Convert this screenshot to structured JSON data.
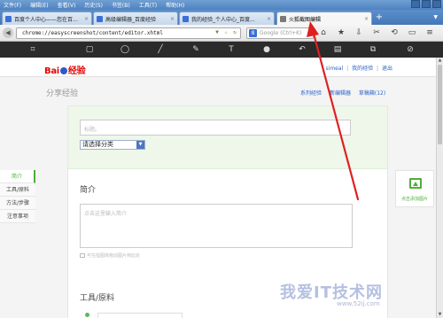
{
  "menubar": {
    "items": [
      "文件(F)",
      "编辑(E)",
      "查看(V)",
      "历史(S)",
      "书签(B)",
      "工具(T)",
      "帮助(H)"
    ]
  },
  "tabs": [
    {
      "label": "百度个人中心——您在百...",
      "favicon_color": "#3b6fd8",
      "active": false
    },
    {
      "label": "高级编辑器_百度经验",
      "favicon_color": "#3b6fd8",
      "active": false
    },
    {
      "label": "我的经验_个人中心_百度...",
      "favicon_color": "#3b6fd8",
      "active": false
    },
    {
      "label": "火狐截图编辑",
      "favicon_color": "#7a7a7a",
      "active": true
    }
  ],
  "navbar": {
    "url": "chrome://easyscreenshot/content/editor.xhtml",
    "search_engine": "8",
    "search_placeholder": "Google (Ctrl+K)"
  },
  "editor_tools": [
    {
      "name": "crop-icon",
      "glyph": "⌗"
    },
    {
      "name": "rectangle-icon",
      "glyph": "▢"
    },
    {
      "name": "ellipse-icon",
      "glyph": "◯"
    },
    {
      "name": "line-icon",
      "glyph": "╱"
    },
    {
      "name": "pencil-icon",
      "glyph": "✎"
    },
    {
      "name": "text-icon",
      "glyph": "T"
    },
    {
      "name": "blur-icon",
      "glyph": "●"
    },
    {
      "name": "undo-icon",
      "glyph": "↶"
    },
    {
      "name": "save-icon",
      "glyph": "▤"
    },
    {
      "name": "copy-icon",
      "glyph": "⧉"
    },
    {
      "name": "cancel-icon",
      "glyph": "⊘"
    }
  ],
  "header": {
    "logo_bai": "Bai",
    "logo_du": "du",
    "logo_jingyan": "经验",
    "user": "simeal",
    "my_experience": "我的经验",
    "logout": "退出"
  },
  "share": {
    "title": "分享经验",
    "series_link": "系列经验",
    "new_editor_link": "新编辑器",
    "drafts_link": "草稿箱(12)"
  },
  "form": {
    "title_placeholder": "标题。",
    "category_placeholder": "请选择分类",
    "intro_heading": "简介",
    "intro_placeholder": "点击这里输入简介",
    "drag_hint": "可在指图库拖动图片到此处",
    "tools_heading": "工具/原料",
    "tool_placeholder": "点击这里输入工具名称"
  },
  "leftnav": {
    "items": [
      "简介",
      "工具/原料",
      "方法/步骤",
      "注意事项"
    ]
  },
  "add_image": {
    "label": "点击添加图片"
  },
  "watermark": {
    "text": "我爱IT技术网",
    "url": "www.52ij.com"
  }
}
